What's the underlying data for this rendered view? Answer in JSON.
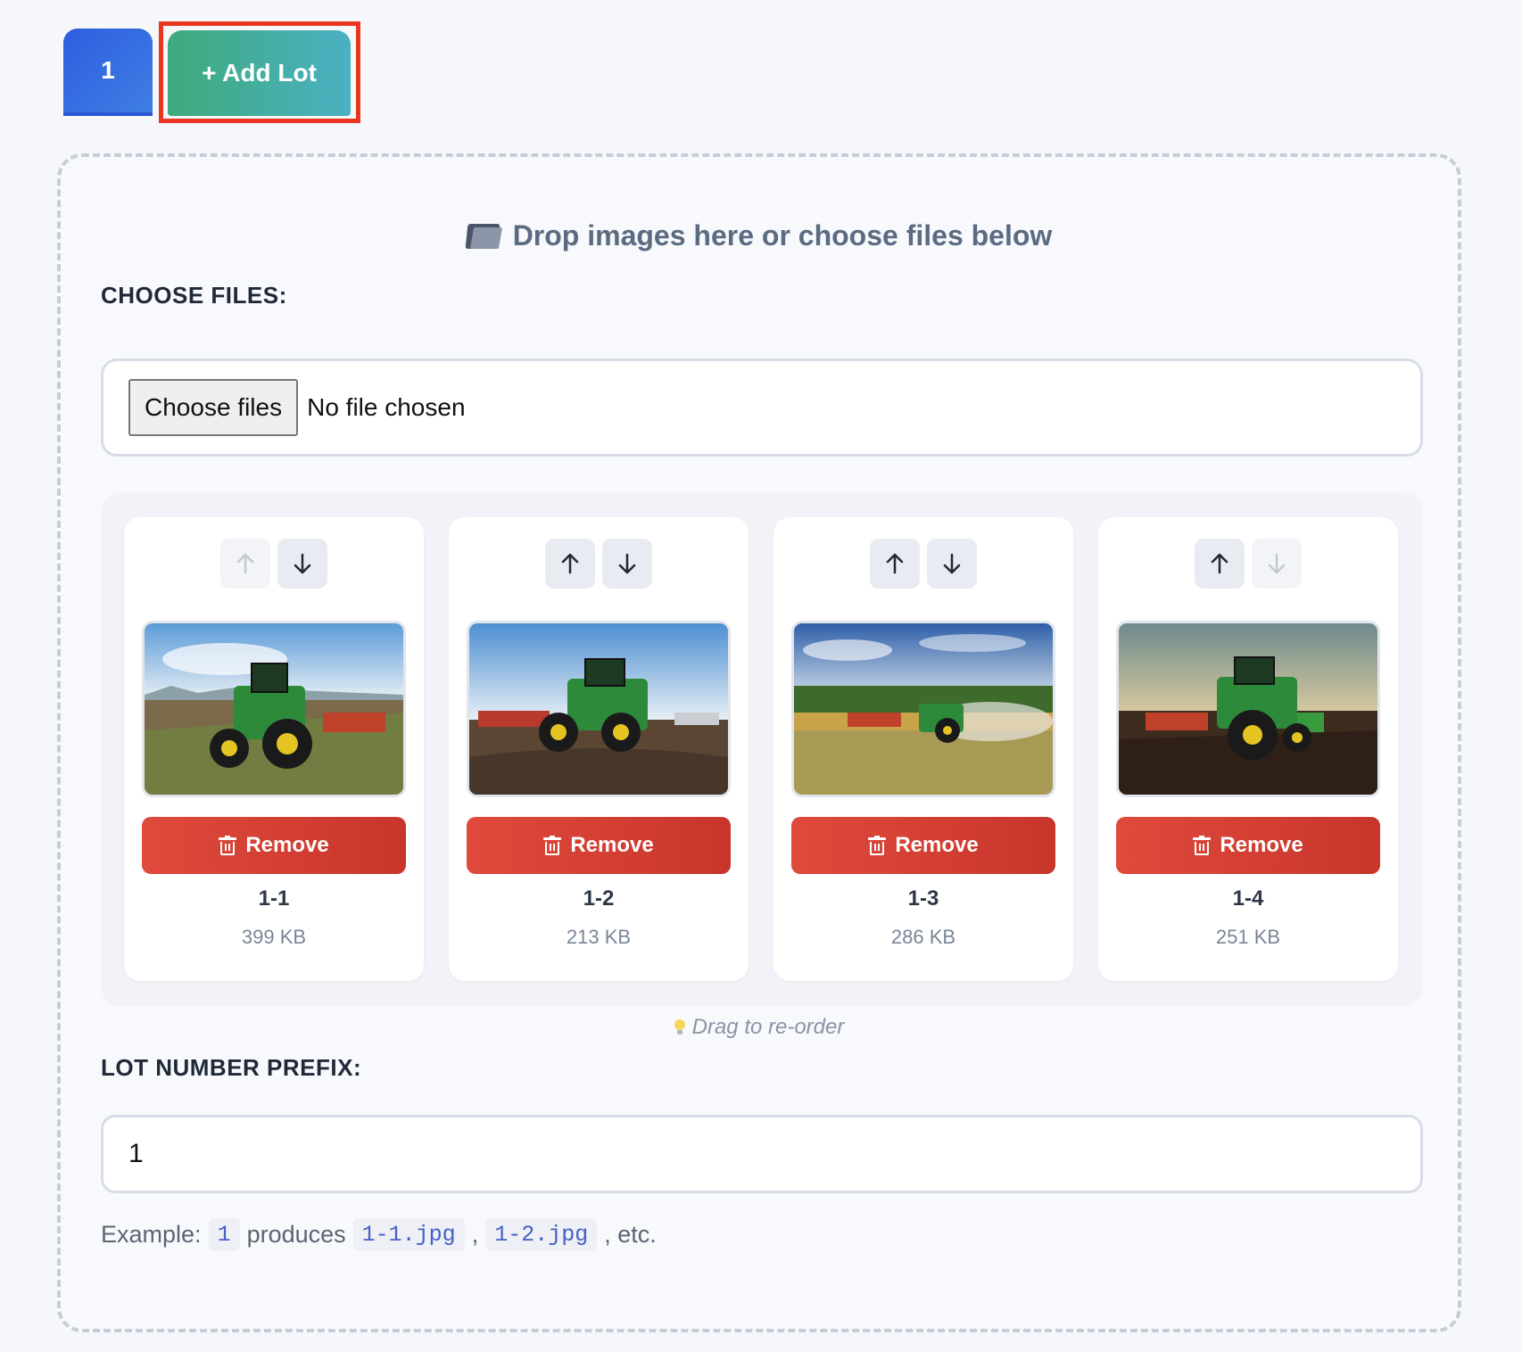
{
  "tabs": {
    "lots": [
      "1"
    ],
    "add_label": "+ Add Lot"
  },
  "dropzone": {
    "hint": "Drop images here or choose files below",
    "choose_files_label": "CHOOSE FILES:",
    "choose_button": "Choose files",
    "no_file_text": "No file chosen",
    "drag_hint": "Drag to re-order",
    "prefix_label": "LOT NUMBER PREFIX:",
    "prefix_value": "1",
    "example": {
      "lead": "Example:",
      "prefix": "1",
      "mid": "produces",
      "file1": "1-1.jpg",
      "sep": ",",
      "file2": "1-2.jpg",
      "tail": ", etc."
    }
  },
  "images": [
    {
      "name": "1-1",
      "size": "399 KB",
      "remove_label": "Remove",
      "up_enabled": false,
      "down_enabled": true
    },
    {
      "name": "1-2",
      "size": "213 KB",
      "remove_label": "Remove",
      "up_enabled": true,
      "down_enabled": true
    },
    {
      "name": "1-3",
      "size": "286 KB",
      "remove_label": "Remove",
      "up_enabled": true,
      "down_enabled": true
    },
    {
      "name": "1-4",
      "size": "251 KB",
      "remove_label": "Remove",
      "up_enabled": true,
      "down_enabled": false
    }
  ],
  "colors": {
    "tab_active": "#2f5ddf",
    "add_lot": "#3eaa7b",
    "remove": "#d8402f",
    "highlight_frame": "#e8361f"
  }
}
